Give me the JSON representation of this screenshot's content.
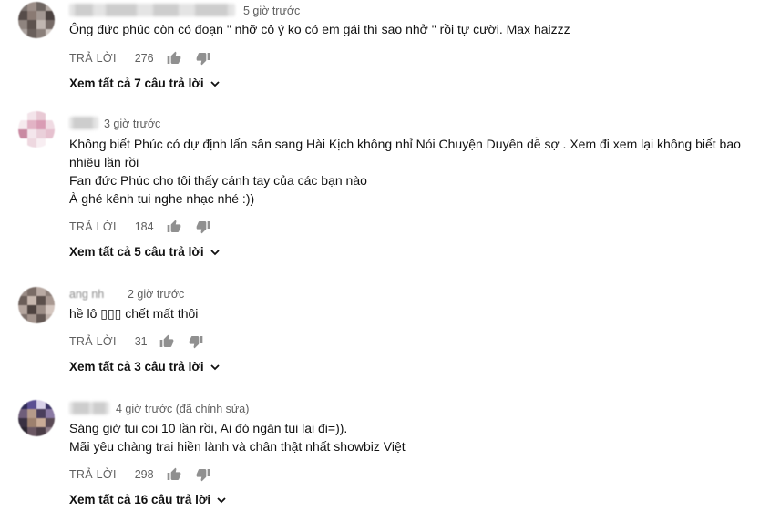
{
  "comments": [
    {
      "time": "5 giờ trước",
      "text": [
        "Ông đức phúc còn có đoạn \" nhỡ cô ý ko có em gái thì sao nhở \" rồi tự cười.  Max haizzz"
      ],
      "reply_label": "TRẢ LỜI",
      "likes": "276",
      "view_replies": "Xem tất cả 7 câu trả lời"
    },
    {
      "time": "3 giờ trước",
      "text": [
        "Không biết Phúc có dự định lấn sân sang Hài Kịch không nhỉ  Nói Chuyện Duyên dễ sợ . Xem đi xem lại không biết bao",
        "nhiêu lần rồi",
        "Fan đức Phúc cho tôi thấy cánh tay của các bạn nào",
        "À ghé kênh tui nghe nhạc nhé :))"
      ],
      "reply_label": "TRẢ LỜI",
      "likes": "184",
      "view_replies": "Xem tất cả 5 câu trả lời"
    },
    {
      "author_partial": "ang nh",
      "time": "2 giờ trước",
      "text": [
        "hề lô ▯▯▯ chết mất thôi"
      ],
      "reply_label": "TRẢ LỜI",
      "likes": "31",
      "view_replies": "Xem tất cả 3 câu trả lời"
    },
    {
      "time": "4 giờ trước (đã chỉnh sửa)",
      "text": [
        "Sáng giờ tui coi 10 lần rồi, Ai đó ngăn tui lại đi=)).",
        "Mãi yêu chàng trai hiền lành và chân thật nhất showbiz Việt"
      ],
      "reply_label": "TRẢ LỜI",
      "likes": "298",
      "view_replies": "Xem tất cả 16 câu trả lời"
    }
  ],
  "icons": {
    "like": "thumbs-up-icon",
    "dislike": "thumbs-down-icon",
    "expand": "chevron-down-icon"
  },
  "colors": {
    "text_primary": "#111111",
    "text_secondary": "#606060",
    "icon": "#909090"
  }
}
